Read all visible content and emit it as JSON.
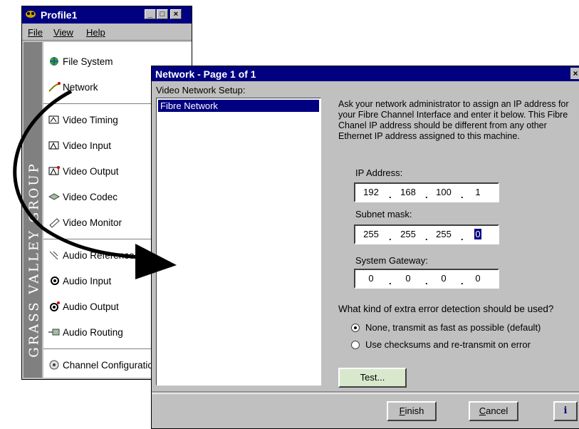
{
  "profile_window": {
    "title": "Profile1",
    "minimize_glyph": "_",
    "maximize_glyph": "□",
    "close_glyph": "×",
    "menu": [
      "File",
      "View",
      "Help"
    ],
    "brand": "GRASS VALLEY GROUP",
    "items": [
      {
        "label": "File System",
        "icon": "globe-icon"
      },
      {
        "label": "Network",
        "icon": "network-icon"
      },
      {
        "label": "Video Timing",
        "icon": "video-timing-icon"
      },
      {
        "label": "Video Input",
        "icon": "video-input-icon"
      },
      {
        "label": "Video Output",
        "icon": "video-output-icon"
      },
      {
        "label": "Video Codec",
        "icon": "video-codec-icon"
      },
      {
        "label": "Video Monitor",
        "icon": "video-monitor-icon"
      },
      {
        "label": "Audio Reference",
        "icon": "audio-reference-icon"
      },
      {
        "label": "Audio Input",
        "icon": "audio-input-icon"
      },
      {
        "label": "Audio Output",
        "icon": "audio-output-icon"
      },
      {
        "label": "Audio Routing",
        "icon": "audio-routing-icon"
      },
      {
        "label": "Channel Configuration",
        "icon": "channel-config-icon"
      }
    ]
  },
  "network_dialog": {
    "title": "Network - Page 1 of 1",
    "close_glyph": "×",
    "setup_label": "Video Network Setup:",
    "list_items": [
      "Fibre Network"
    ],
    "description": "Ask your network administrator to assign an IP address for your Fibre Channel Interface and enter it below. This Fibre Chanel IP address should be different from any other Ethernet IP address assigned to this machine.",
    "ip_label": "IP Address:",
    "ip": [
      "192",
      "168",
      "100",
      "1"
    ],
    "subnet_label": "Subnet mask:",
    "subnet": [
      "255",
      "255",
      "255",
      "0"
    ],
    "gateway_label": "System Gateway:",
    "gateway": [
      "0",
      "0",
      "0",
      "0"
    ],
    "error_question": "What kind of extra error detection should be used?",
    "option_none": "None, transmit as fast as possible (default)",
    "option_checksum": "Use checksums and re-transmit on error",
    "selected_option": "none",
    "test_button": "Test...",
    "finish_button": "Finish",
    "cancel_button": "Cancel",
    "info_button": "i"
  }
}
